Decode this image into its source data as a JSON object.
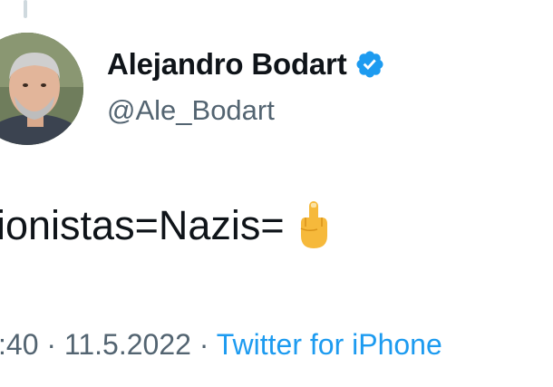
{
  "tweet": {
    "author": {
      "display_name": "Alejandro Bodart",
      "handle": "@Ale_Bodart",
      "verified": true,
      "verified_icon": "verified-badge-icon",
      "verified_color": "#1d9bf0"
    },
    "text": "ionistas=Nazis=",
    "emoji_icon": "middle-finger-emoji-icon",
    "time": ":40",
    "separator": " · ",
    "date": "11.5.2022",
    "source": "Twitter for iPhone",
    "source_color": "#1d9bf0"
  },
  "colors": {
    "text_primary": "#0f1419",
    "text_secondary": "#536471",
    "background": "#ffffff"
  }
}
